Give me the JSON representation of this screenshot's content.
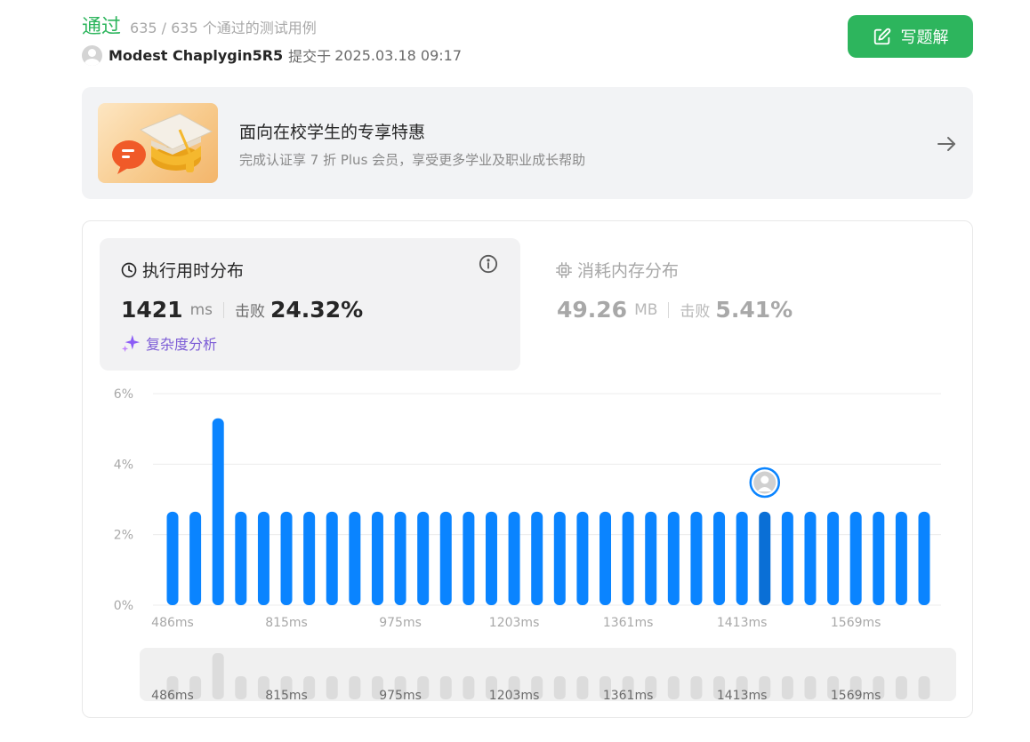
{
  "header": {
    "status": "通过",
    "passed_detail": "635 / 635 个通过的测试用例",
    "user_name": "Modest Chaplygin5R5",
    "submit_label": "提交于",
    "submit_time": "2025.03.18 09:17",
    "write_button": "写题解"
  },
  "promo": {
    "title": "面向在校学生的专享特惠",
    "subtitle": "完成认证享 7 折 Plus 会员，享受更多学业及职业成长帮助"
  },
  "runtime": {
    "title": "执行用时分布",
    "value": "1421",
    "unit": "ms",
    "beat_label": "击败",
    "beat_value": "24.32%",
    "complexity_label": "复杂度分析"
  },
  "memory": {
    "title": "消耗内存分布",
    "value": "49.26",
    "unit": "MB",
    "beat_label": "击败",
    "beat_value": "5.41%"
  },
  "colors": {
    "accent_green": "#2db55d",
    "bar_blue": "#0a84ff",
    "bar_selected": "#0a6fd6",
    "range_bar": "#dcdcdc"
  },
  "chart_data": {
    "type": "bar",
    "title": "",
    "xlabel": "",
    "ylabel": "",
    "ylim": [
      0,
      6
    ],
    "y_ticks": [
      "6%",
      "4%",
      "2%",
      "0%"
    ],
    "x_tick_labels": [
      "486ms",
      "815ms",
      "975ms",
      "1203ms",
      "1361ms",
      "1413ms",
      "1569ms"
    ],
    "x_tick_positions": [
      0,
      5,
      10,
      15,
      20,
      25,
      30
    ],
    "values": [
      2.65,
      2.65,
      5.3,
      2.65,
      2.65,
      2.65,
      2.65,
      2.65,
      2.65,
      2.65,
      2.65,
      2.65,
      2.65,
      2.65,
      2.65,
      2.65,
      2.65,
      2.65,
      2.65,
      2.65,
      2.65,
      2.65,
      2.65,
      2.65,
      2.65,
      2.65,
      2.65,
      2.65,
      2.65,
      2.65,
      2.65,
      2.65,
      2.65,
      2.65
    ],
    "selected_index": 26,
    "grid": true
  }
}
